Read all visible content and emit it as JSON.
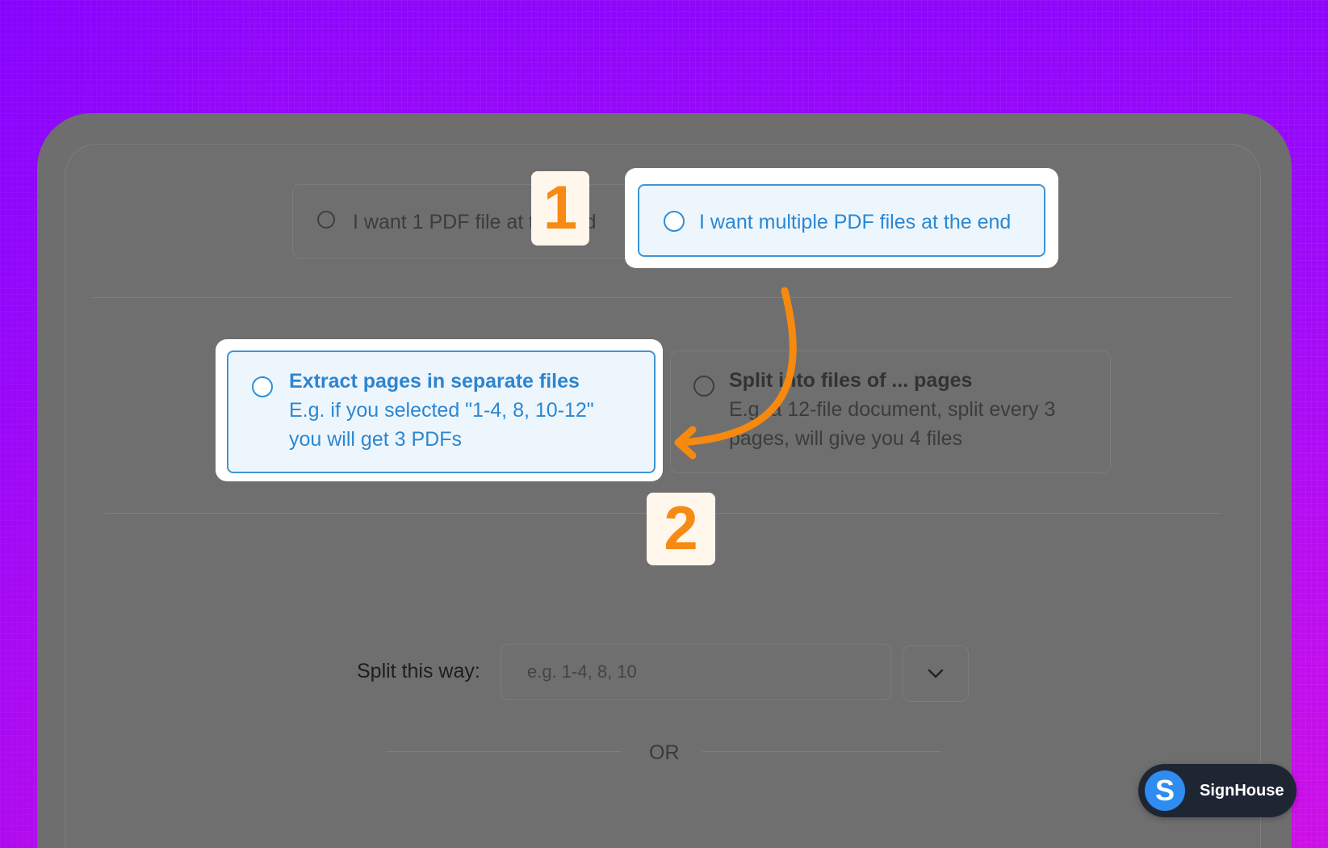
{
  "options_top": {
    "single": {
      "label": "I want 1 PDF file at the end"
    },
    "multiple": {
      "label": "I want multiple PDF files at the end"
    }
  },
  "options_mode": {
    "extract": {
      "title": "Extract pages in separate files",
      "line1": "E.g. if you selected \"1-4, 8, 10-12\"",
      "line2": "you will get 3 PDFs"
    },
    "split": {
      "title": "Split into files of ... pages",
      "line1": "E.g. a 12-file document, split every 3",
      "line2": "pages, will give you 4 files"
    }
  },
  "badges": {
    "step1": "1",
    "step2": "2"
  },
  "split_row": {
    "label": "Split this way:",
    "placeholder": "e.g. 1-4, 8, 10"
  },
  "or_label": "OR",
  "brand": {
    "logo_letter": "S",
    "name": "SignHouse"
  },
  "colors": {
    "accent_blue": "#2b87d1",
    "badge_orange": "#f78a14",
    "arrow_orange": "#f7890f",
    "background_purple": "#9a08f8"
  }
}
